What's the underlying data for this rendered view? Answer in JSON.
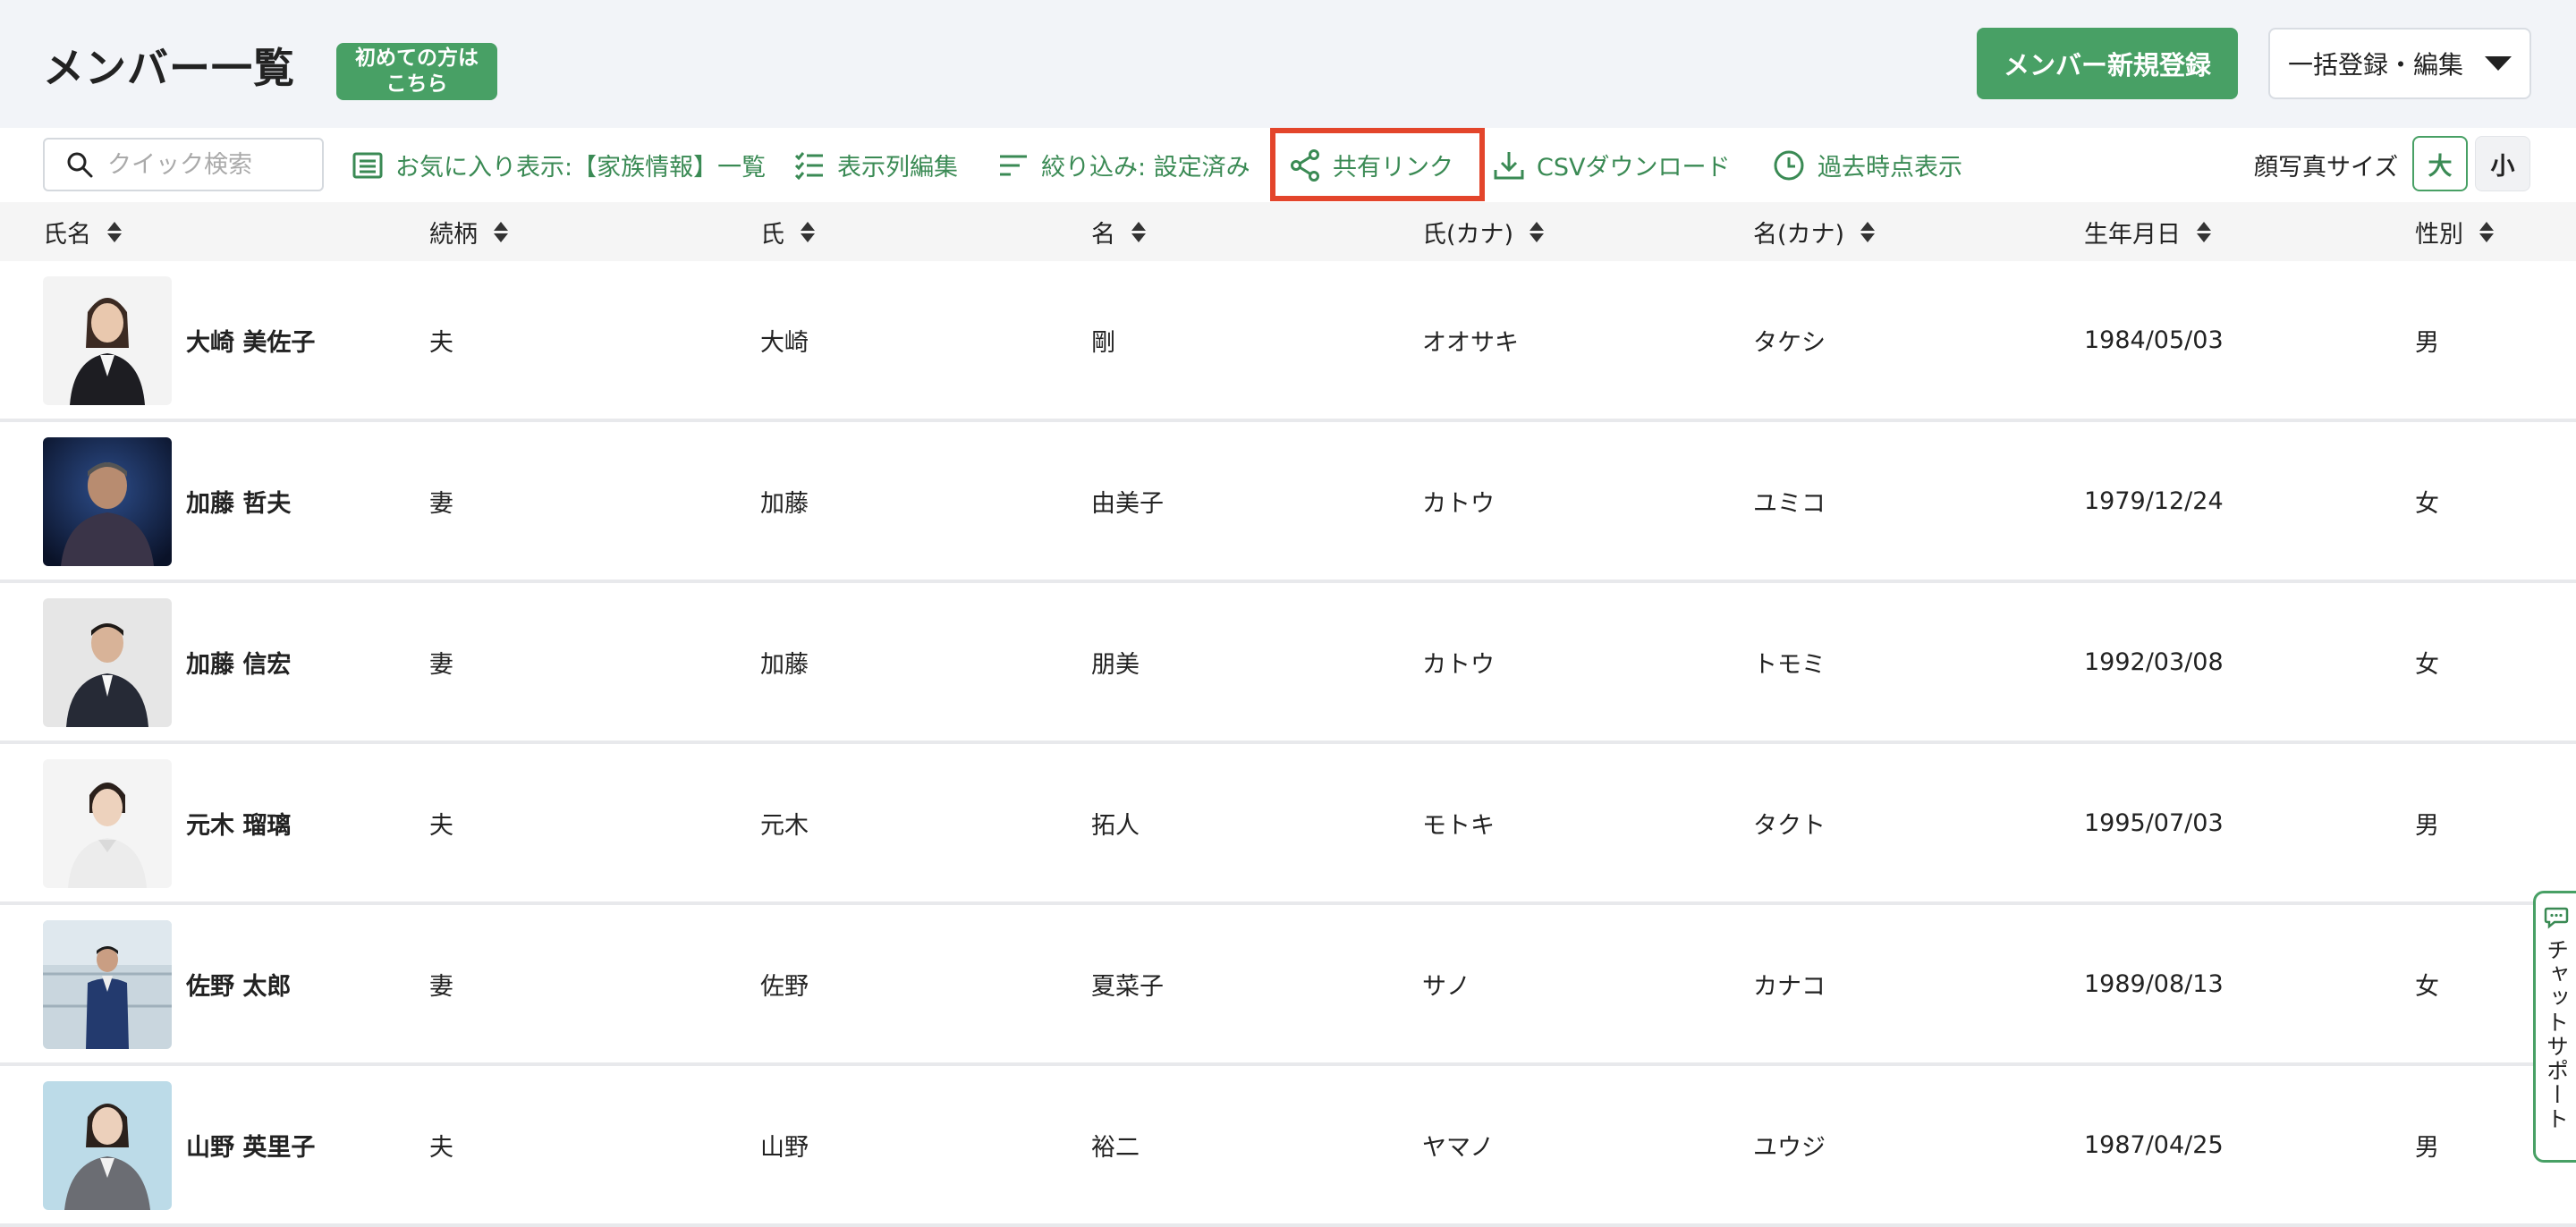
{
  "header": {
    "title": "メンバー一覧",
    "beginner_badge_line1": "初めての方は",
    "beginner_badge_line2": "こちら",
    "new_member_button": "メンバー新規登録",
    "bulk_button": "一括登録・編集"
  },
  "toolbar": {
    "search_placeholder": "クイック検索",
    "favorites": "お気に入り表示:【家族情報】一覧",
    "edit_columns": "表示列編集",
    "filter": "絞り込み: 設定済み",
    "share_link": "共有リンク",
    "csv_download": "CSVダウンロード",
    "past_view": "過去時点表示",
    "photo_size_label": "顔写真サイズ",
    "photo_size_large": "大",
    "photo_size_small": "小"
  },
  "colors": {
    "accent_green": "#48a065",
    "link_green": "#3a8a54",
    "highlight_red": "#e3452b"
  },
  "table": {
    "columns": [
      "氏名",
      "続柄",
      "氏",
      "名",
      "氏(カナ)",
      "名(カナ)",
      "生年月日",
      "性別"
    ],
    "rows": [
      {
        "name": "大崎 美佐子",
        "relation": "夫",
        "last": "大崎",
        "first": "剛",
        "last_kana": "オオサキ",
        "first_kana": "タケシ",
        "birthday": "1984/05/03",
        "gender": "男"
      },
      {
        "name": "加藤 哲夫",
        "relation": "妻",
        "last": "加藤",
        "first": "由美子",
        "last_kana": "カトウ",
        "first_kana": "ユミコ",
        "birthday": "1979/12/24",
        "gender": "女"
      },
      {
        "name": "加藤 信宏",
        "relation": "妻",
        "last": "加藤",
        "first": "朋美",
        "last_kana": "カトウ",
        "first_kana": "トモミ",
        "birthday": "1992/03/08",
        "gender": "女"
      },
      {
        "name": "元木 瑠璃",
        "relation": "夫",
        "last": "元木",
        "first": "拓人",
        "last_kana": "モトキ",
        "first_kana": "タクト",
        "birthday": "1995/07/03",
        "gender": "男"
      },
      {
        "name": "佐野 太郎",
        "relation": "妻",
        "last": "佐野",
        "first": "夏菜子",
        "last_kana": "サノ",
        "first_kana": "カナコ",
        "birthday": "1989/08/13",
        "gender": "女"
      },
      {
        "name": "山野 英里子",
        "relation": "夫",
        "last": "山野",
        "first": "裕二",
        "last_kana": "ヤマノ",
        "first_kana": "ユウジ",
        "birthday": "1987/04/25",
        "gender": "男"
      }
    ]
  },
  "chat_support": "チャットサポート"
}
